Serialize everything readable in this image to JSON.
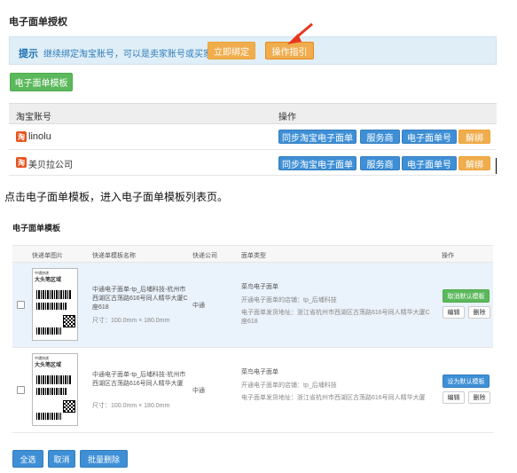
{
  "header": {
    "title": "电子面单授权"
  },
  "tip": {
    "label": "提示",
    "text": "继续绑定淘宝账号，可以是卖家账号或买家账号。",
    "bind_button": "立即绑定",
    "guide_button": "操作指引"
  },
  "template_button": "电子面单模板",
  "accounts_table": {
    "columns": [
      "淘宝账号",
      "操作"
    ],
    "rows": [
      {
        "account": "linolu",
        "actions": [
          "同步淘宝电子面单",
          "服务商",
          "电子面单号",
          "解绑"
        ]
      },
      {
        "account": "美贝拉公司",
        "actions": [
          "同步淘宝电子面单",
          "服务商",
          "电子面单号",
          "解绑"
        ]
      }
    ],
    "icon_char": "淘"
  },
  "instruction": "点击电子面单模板，进入电子面单模板列表页。",
  "templates": {
    "title": "电子面单模板",
    "columns": [
      "快递单图片",
      "快递单模板名称",
      "快递公司",
      "面单类型",
      "操作"
    ],
    "rows": [
      {
        "name": "中通电子面单-tp_后埔科技-杭州市西湖区古荡路616号同人精华大厦C座618",
        "size": "尺寸：100.0mm × 180.0mm",
        "company": "中通",
        "type_title": "菜鸟电子面单",
        "type_shop": "开通电子面单的店铺：tp_后埔科技",
        "type_addr": "电子面单发货地址：浙江省杭州市西湖区古荡路616号同人精华大厦C座618",
        "primary_action": "取消默认模板",
        "edit": "编辑",
        "delete": "删除",
        "img_title": "大头笔区域"
      },
      {
        "name": "中通电子面单-tp_后埔科技-杭州市西湖区古荡路616号同人精华大厦",
        "size": "尺寸：100.0mm × 180.0mm",
        "company": "中通",
        "type_title": "菜鸟电子面单",
        "type_shop": "开通电子面单的店铺：tp_后埔科技",
        "type_addr": "电子面单发货地址：浙江省杭州市西湖区古荡路616号同人精华大厦",
        "primary_action": "设为默认模板",
        "edit": "编辑",
        "delete": "删除",
        "img_title": "大头笔区域"
      }
    ]
  },
  "footer": {
    "select_all": "全选",
    "cancel": "取消",
    "batch_delete": "批量删除"
  },
  "colors": {
    "orange": "#f0ad4e",
    "green": "#5cb85c",
    "blue": "#3e8fd6",
    "arrow": "#e8361f"
  }
}
